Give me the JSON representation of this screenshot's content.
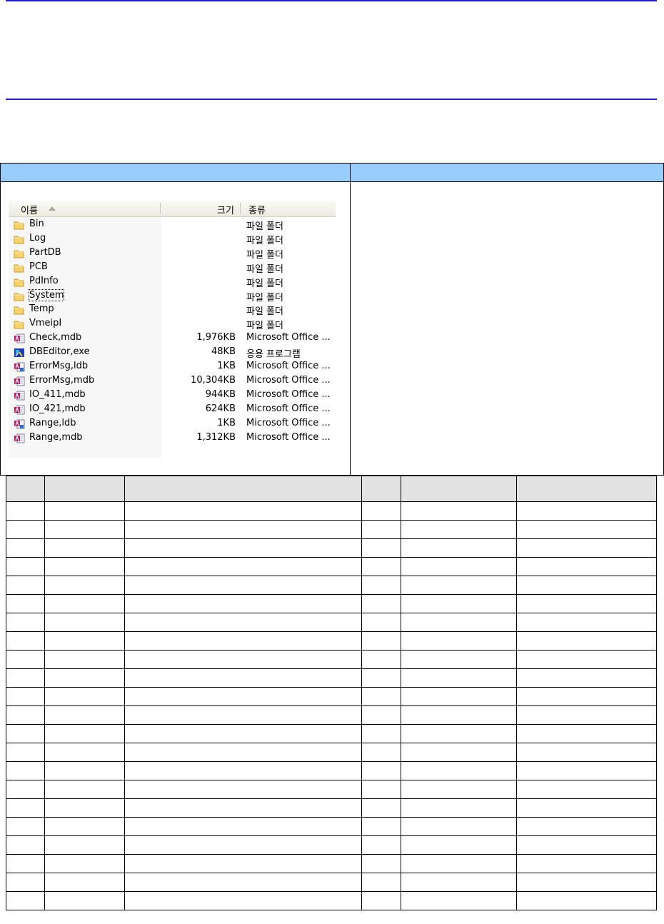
{
  "explorer": {
    "header": {
      "name": "이름",
      "size": "크기",
      "type": "종류"
    },
    "files": [
      {
        "name": "Bin",
        "size": "",
        "type": "파일 폴더",
        "icon": "folder-icon"
      },
      {
        "name": "Log",
        "size": "",
        "type": "파일 폴더",
        "icon": "folder-icon"
      },
      {
        "name": "PartDB",
        "size": "",
        "type": "파일 폴더",
        "icon": "folder-icon"
      },
      {
        "name": "PCB",
        "size": "",
        "type": "파일 폴더",
        "icon": "folder-icon"
      },
      {
        "name": "PdInfo",
        "size": "",
        "type": "파일 폴더",
        "icon": "folder-icon"
      },
      {
        "name": "System",
        "size": "",
        "type": "파일 폴더",
        "icon": "folder-icon",
        "selected": true
      },
      {
        "name": "Temp",
        "size": "",
        "type": "파일 폴더",
        "icon": "folder-icon"
      },
      {
        "name": "VmeipI",
        "size": "",
        "type": "파일 폴더",
        "icon": "folder-icon"
      },
      {
        "name": "Check,mdb",
        "size": "1,976KB",
        "type": "Microsoft Office ...",
        "icon": "access-db-icon"
      },
      {
        "name": "DBEditor,exe",
        "size": "48KB",
        "type": "응용 프로그램",
        "icon": "application-icon"
      },
      {
        "name": "ErrorMsg,ldb",
        "size": "1KB",
        "type": "Microsoft Office ...",
        "icon": "access-lock-icon"
      },
      {
        "name": "ErrorMsg,mdb",
        "size": "10,304KB",
        "type": "Microsoft Office ...",
        "icon": "access-db-icon"
      },
      {
        "name": "IO_411,mdb",
        "size": "944KB",
        "type": "Microsoft Office ...",
        "icon": "access-db-icon"
      },
      {
        "name": "IO_421,mdb",
        "size": "624KB",
        "type": "Microsoft Office ...",
        "icon": "access-db-icon"
      },
      {
        "name": "Range,ldb",
        "size": "1KB",
        "type": "Microsoft Office ...",
        "icon": "access-lock-icon"
      },
      {
        "name": "Range,mdb",
        "size": "1,312KB",
        "type": "Microsoft Office ...",
        "icon": "access-db-icon"
      }
    ]
  },
  "colors": {
    "rule": "#1c1cc8",
    "panel_header": "#99ccff",
    "table_header": "#e2e2e2"
  }
}
